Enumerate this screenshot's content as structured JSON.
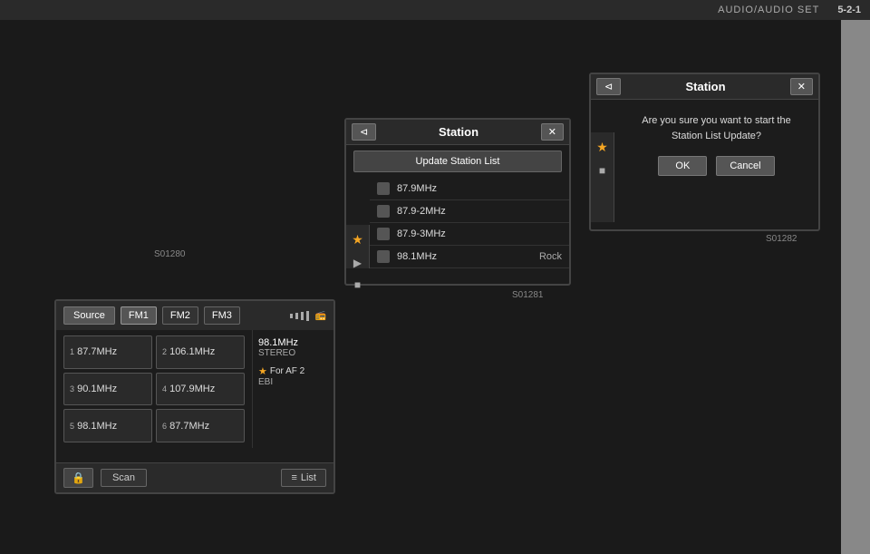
{
  "header": {
    "title": "AUDIO/AUDIO SET",
    "page": "5-2-1"
  },
  "panel_radio": {
    "source_label": "Source",
    "fm1_label": "FM1",
    "fm2_label": "FM2",
    "fm3_label": "FM3",
    "stations": [
      {
        "freq": "87.7MHz",
        "num": "1"
      },
      {
        "freq": "106.1MHz",
        "num": "2"
      },
      {
        "freq": "90.1MHz",
        "num": "3"
      },
      {
        "freq": "107.9MHz",
        "num": "4"
      },
      {
        "freq": "98.1MHz",
        "num": "5"
      },
      {
        "freq": "87.7MHz",
        "num": "6"
      }
    ],
    "current_freq": "98.1MHz",
    "current_mode": "STEREO",
    "af_label": "For AF 2",
    "ebi_label": "EBI",
    "scan_label": "Scan",
    "list_label": "List",
    "code": "S01280"
  },
  "panel_station": {
    "back_label": "⊲",
    "title": "Station",
    "close_label": "✕",
    "update_label": "Update Station List",
    "items": [
      {
        "freq": "87.9MHz",
        "genre": ""
      },
      {
        "freq": "87.9-2MHz",
        "genre": ""
      },
      {
        "freq": "87.9-3MHz",
        "genre": ""
      },
      {
        "freq": "98.1MHz",
        "genre": "Rock"
      }
    ],
    "code": "S01281"
  },
  "panel_confirm": {
    "back_label": "⊲",
    "title": "Station",
    "close_label": "✕",
    "message_line1": "Are you sure you want to start the",
    "message_line2": "Station List Update?",
    "ok_label": "OK",
    "cancel_label": "Cancel",
    "code": "S01282"
  }
}
